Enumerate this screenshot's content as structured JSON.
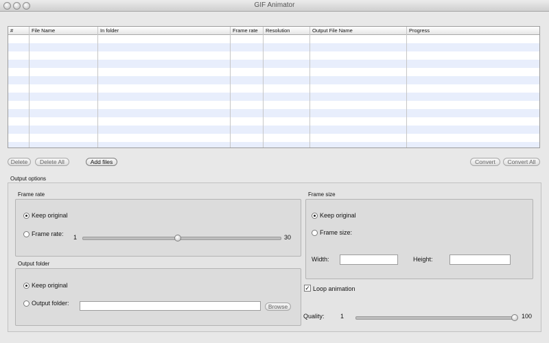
{
  "window": {
    "title": "GIF Animator"
  },
  "table": {
    "columns": [
      "#",
      "File Name",
      "In folder",
      "Frame rate",
      "Resolution",
      "Output File Name",
      "Progress"
    ],
    "rows": []
  },
  "buttons": {
    "delete": "Delete",
    "delete_all": "Delete All",
    "add_files": "Add files",
    "convert": "Convert",
    "convert_all": "Convert All",
    "browse": "Browse"
  },
  "output_options": {
    "title": "Output options",
    "frame_rate": {
      "title": "Frame rate",
      "keep_original": "Keep original",
      "frame_rate_label": "Frame rate:",
      "selected": "keep_original",
      "slider_min": "1",
      "slider_max": "30",
      "slider_value": 15
    },
    "frame_size": {
      "title": "Frame size",
      "keep_original": "Keep original",
      "frame_size_label": "Frame size:",
      "selected": "keep_original",
      "width_label": "Width:",
      "width_value": "",
      "height_label": "Height:",
      "height_value": ""
    },
    "output_folder": {
      "title": "Output folder",
      "keep_original": "Keep original",
      "output_folder_label": "Output folder:",
      "selected": "keep_original",
      "path_value": ""
    },
    "loop_animation": {
      "label": "Loop animation",
      "checked": true
    },
    "quality": {
      "label": "Quality:",
      "min": "1",
      "max": "100",
      "value": 100
    }
  }
}
